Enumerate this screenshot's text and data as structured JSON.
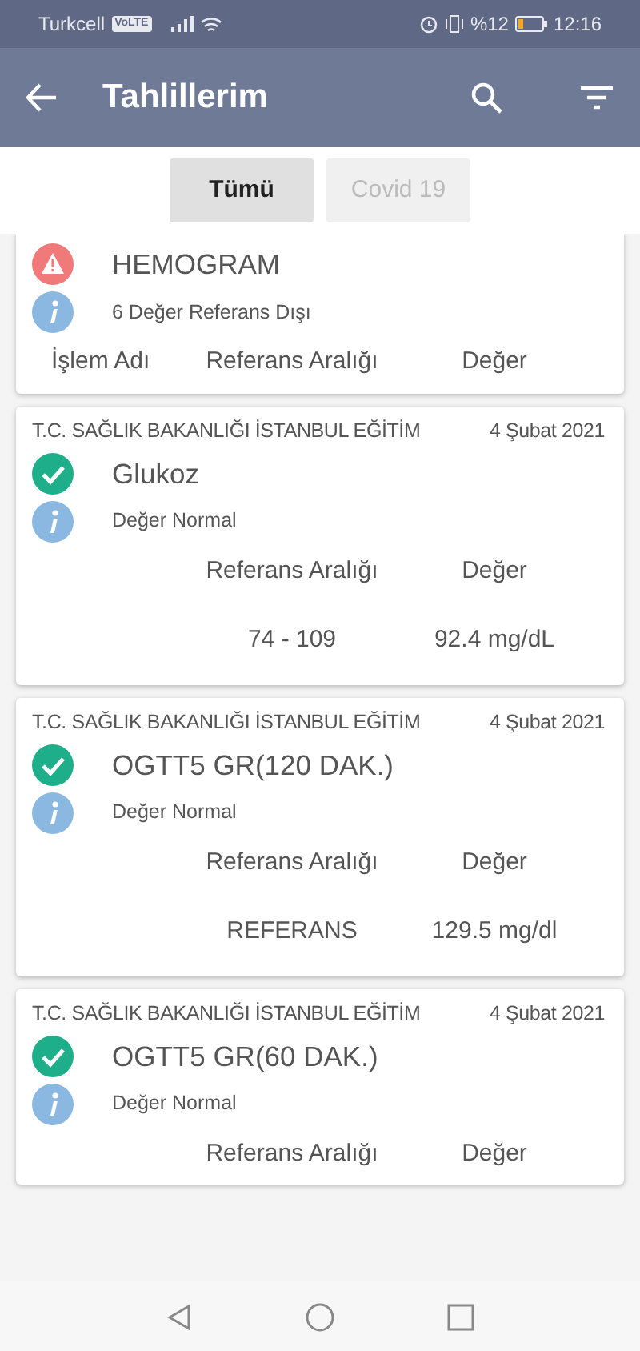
{
  "status_bar": {
    "carrier": "Turkcell",
    "network_badge": "VoLTE",
    "battery": "%12",
    "time": "12:16"
  },
  "app_bar": {
    "title": "Tahlillerim"
  },
  "tabs": [
    {
      "label": "Tümü",
      "selected": true
    },
    {
      "label": "Covid 19",
      "selected": false
    }
  ],
  "results": [
    {
      "kind": "warning",
      "name": "HEMOGRAM",
      "note": "6 Değer Referans Dışı",
      "headers": {
        "name": "İşlem Adı",
        "range": "Referans Aralığı",
        "value": "Değer"
      }
    },
    {
      "kind": "normal",
      "institution": "T.C. SAĞLIK BAKANLIĞI İSTANBUL EĞİTİM",
      "date": "4 Şubat 2021",
      "name": "Glukoz",
      "note": "Değer Normal",
      "headers": {
        "range": "Referans Aralığı",
        "value": "Değer"
      },
      "result": {
        "range": "74 - 109",
        "value": "92.4 mg/dL"
      }
    },
    {
      "kind": "normal",
      "institution": "T.C. SAĞLIK BAKANLIĞI İSTANBUL EĞİTİM",
      "date": "4 Şubat 2021",
      "name": "OGTT5 GR(120 DAK.)",
      "note": "Değer Normal",
      "headers": {
        "range": "Referans Aralığı",
        "value": "Değer"
      },
      "result": {
        "range": "REFERANS",
        "value": "129.5 mg/dl"
      }
    },
    {
      "kind": "normal",
      "institution": "T.C. SAĞLIK BAKANLIĞI İSTANBUL EĞİTİM",
      "date": "4 Şubat 2021",
      "name": "OGTT5 GR(60 DAK.)",
      "note": "Değer Normal",
      "headers": {
        "range": "Referans Aralığı",
        "value": "Değer"
      }
    }
  ]
}
